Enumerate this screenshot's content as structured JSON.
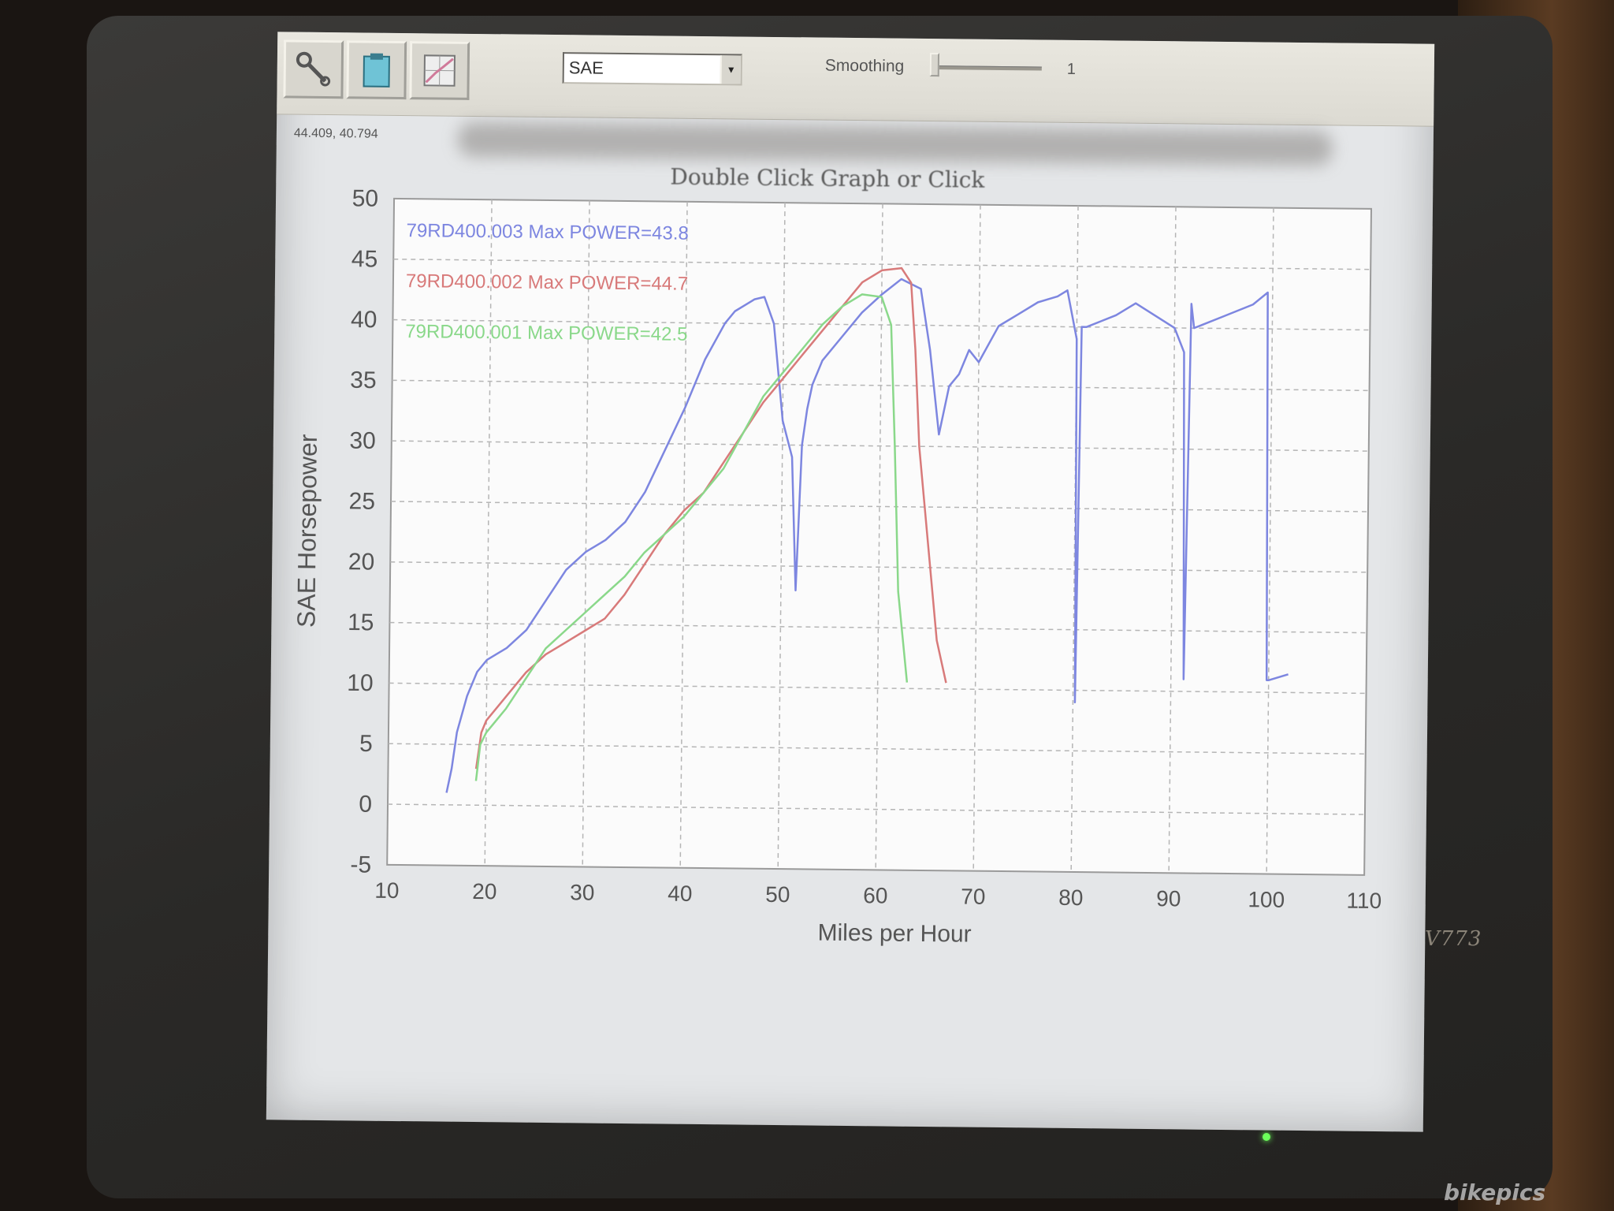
{
  "toolbar": {
    "units_value": "SAE",
    "smoothing_label": "Smoothing",
    "smoothing_value": "1"
  },
  "coordinates": "44.409, 40.794",
  "graph_title": "Double Click Graph or Click",
  "monitor_model": "V773",
  "watermark": "bikepics",
  "chart_data": {
    "type": "line",
    "xlabel": "Miles per Hour",
    "ylabel": "SAE Horsepower",
    "xlim": [
      10,
      110
    ],
    "ylim": [
      -5,
      50
    ],
    "grid": true,
    "x_ticks": [
      "10",
      "20",
      "30",
      "40",
      "50",
      "60",
      "70",
      "80",
      "90",
      "100",
      "110"
    ],
    "y_ticks": [
      "-5",
      "0",
      "5",
      "10",
      "15",
      "20",
      "25",
      "30",
      "35",
      "40",
      "45",
      "50"
    ],
    "legend_position": "top-left",
    "legend": [
      "79RD400.003  Max POWER=43.8",
      "79RD400.002  Max POWER=44.7",
      "79RD400.001  Max POWER=42.5"
    ],
    "series": [
      {
        "name": "79RD400.003",
        "color": "#7d86e0",
        "x": [
          16,
          16.5,
          17,
          18,
          19,
          20,
          22,
          24,
          26,
          28,
          30,
          32,
          34,
          36,
          38,
          40,
          42,
          44,
          45,
          46,
          47,
          48,
          49,
          50,
          51,
          51.5,
          52,
          52.5,
          53,
          54,
          56,
          58,
          60,
          62,
          64,
          65,
          66,
          67,
          68,
          69,
          70,
          72,
          74,
          76,
          78,
          79,
          80,
          80.2,
          80.5,
          81,
          84,
          86,
          88,
          90,
          91,
          91.3,
          91.7,
          92,
          95,
          98,
          99.5,
          99.8,
          100,
          102
        ],
        "y": [
          1,
          3,
          6,
          9,
          11,
          12,
          13,
          14.5,
          17,
          19.5,
          21,
          22,
          23.5,
          26,
          29.5,
          33,
          37,
          40,
          41,
          41.5,
          42,
          42.2,
          40,
          32,
          29,
          18,
          30,
          33,
          35,
          37,
          39,
          41,
          42.5,
          43.8,
          43,
          38,
          31,
          35,
          36,
          38,
          37,
          40,
          41,
          42,
          42.5,
          43,
          39,
          9,
          40,
          40,
          41,
          42,
          41,
          40,
          38,
          11,
          42,
          40,
          41,
          42,
          43,
          11,
          11,
          11.5
        ]
      },
      {
        "name": "79RD400.002",
        "color": "#d87a7a",
        "x": [
          19,
          19.5,
          20,
          22,
          24,
          26,
          28,
          30,
          32,
          34,
          36,
          38,
          40,
          42,
          44,
          46,
          48,
          50,
          52,
          54,
          56,
          58,
          60,
          62,
          63,
          63.5,
          64,
          65,
          66,
          67
        ],
        "y": [
          3,
          6,
          7,
          9,
          11,
          12.5,
          13.5,
          14.5,
          15.5,
          17.5,
          20,
          22.5,
          24.5,
          26,
          28.5,
          31,
          33.5,
          35.5,
          37.5,
          39.5,
          41.5,
          43.5,
          44.5,
          44.7,
          43.5,
          38,
          30,
          22,
          14,
          10.5
        ]
      },
      {
        "name": "79RD400.001",
        "color": "#8ad88a",
        "x": [
          19,
          19.4,
          20,
          22,
          24,
          26,
          28,
          30,
          32,
          34,
          36,
          38,
          40,
          42,
          44,
          46,
          48,
          50,
          52,
          54,
          56,
          58,
          60,
          61,
          61.5,
          62,
          63
        ],
        "y": [
          2,
          5,
          6,
          8,
          10.5,
          13,
          14.5,
          16,
          17.5,
          19,
          21,
          22.5,
          24,
          26,
          28,
          31,
          34,
          36,
          38,
          40,
          41.5,
          42.5,
          42.3,
          40,
          30,
          18,
          10.5
        ]
      }
    ]
  }
}
